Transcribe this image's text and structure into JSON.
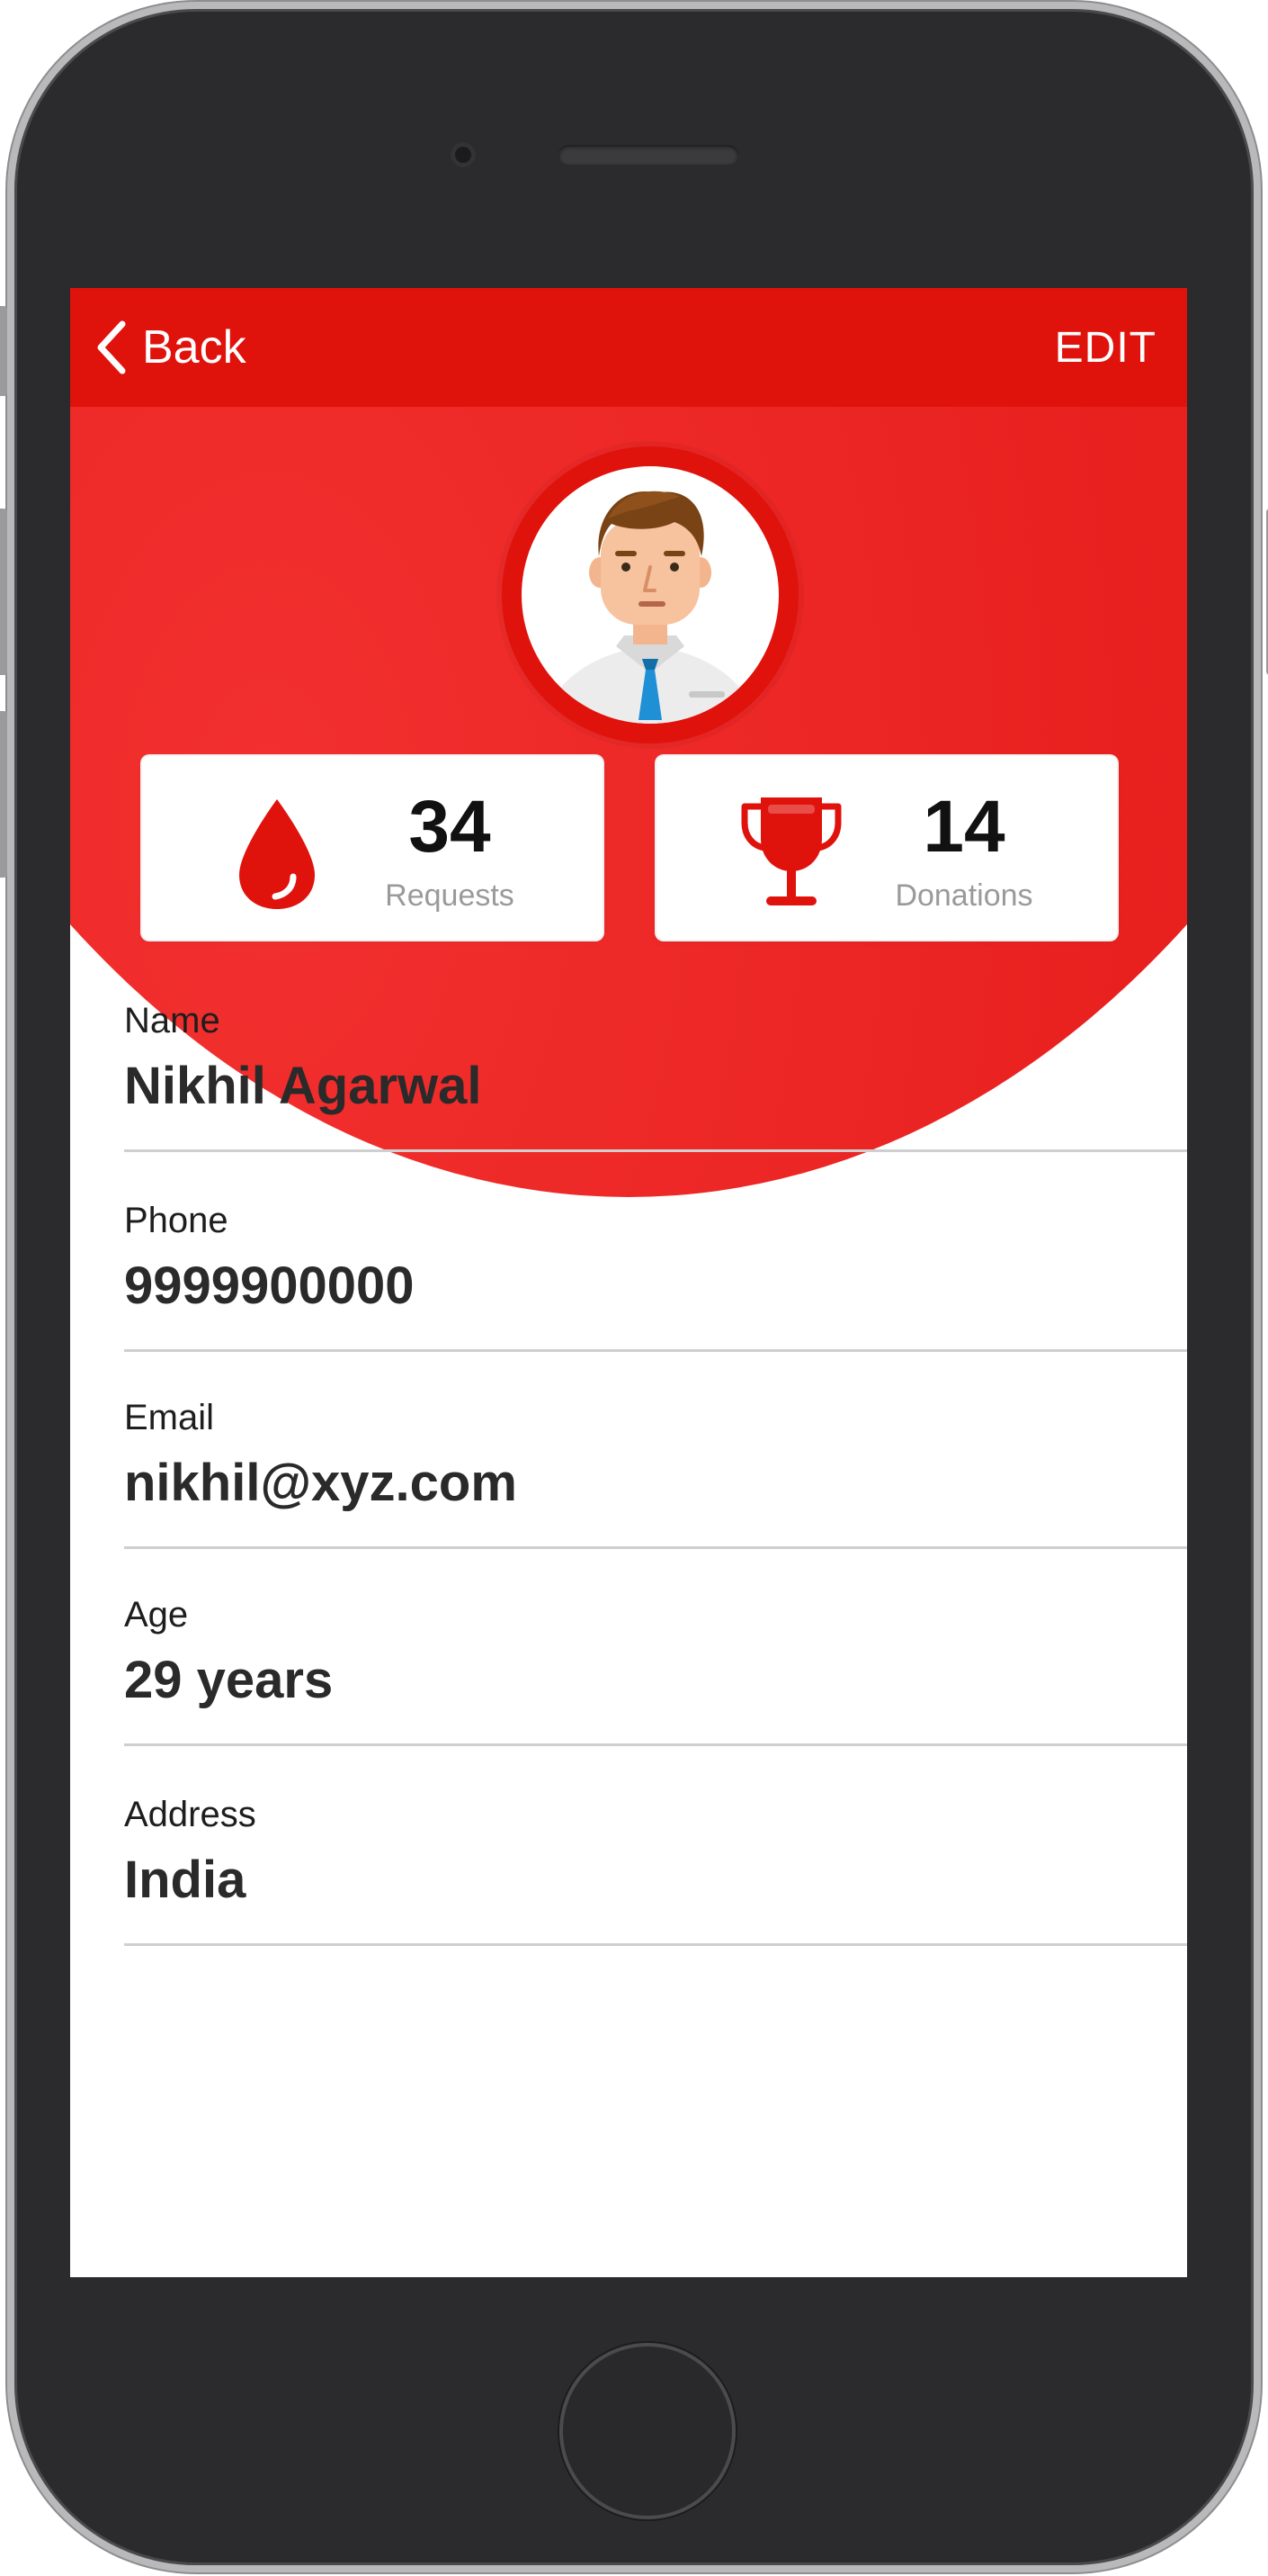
{
  "nav": {
    "back_label": "Back",
    "edit_label": "EDIT"
  },
  "stats": [
    {
      "value": "34",
      "label": "Requests",
      "icon": "blood-drop-icon"
    },
    {
      "value": "14",
      "label": "Donations",
      "icon": "trophy-icon"
    }
  ],
  "profile": {
    "fields": [
      {
        "label": "Name",
        "value": "Nikhil Agarwal"
      },
      {
        "label": "Phone",
        "value": "9999900000"
      },
      {
        "label": "Email",
        "value": "nikhil@xyz.com"
      },
      {
        "label": "Age",
        "value": "29 years"
      },
      {
        "label": "Address",
        "value": "India"
      }
    ]
  },
  "colors": {
    "brand_red": "#e0120c",
    "text_dark": "#2a2a2a",
    "text_muted": "#9a9a9a",
    "divider": "#cfcfcf"
  }
}
